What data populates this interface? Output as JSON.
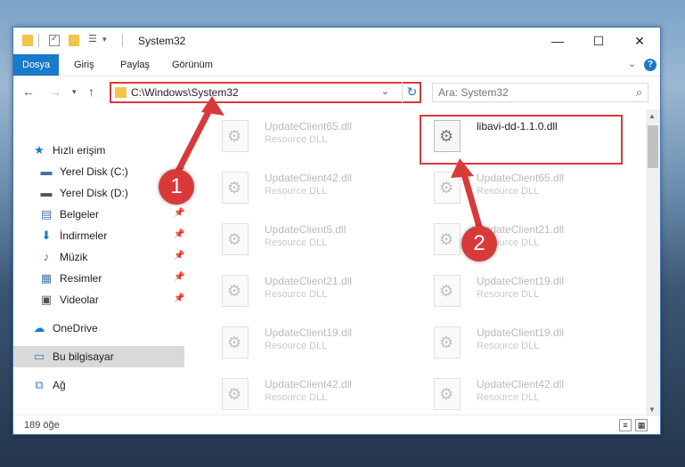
{
  "window": {
    "title": "System32",
    "controls": {
      "minimize": "—",
      "maximize": "☐",
      "close": "✕"
    }
  },
  "ribbon": {
    "tabs": [
      "Dosya",
      "Giriş",
      "Paylaş",
      "Görünüm"
    ],
    "active_tab": "Dosya",
    "help": "?"
  },
  "address_bar": {
    "path": "C:\\Windows\\System32",
    "dropdown": "⌄",
    "refresh": "↻"
  },
  "search": {
    "placeholder": "Ara: System32"
  },
  "sidebar": {
    "items": [
      {
        "label": "Hızlı erişim",
        "icon": "star-icon",
        "glyph": "★",
        "color": "#1979ca",
        "pinned": false
      },
      {
        "label": "Yerel Disk (C:)",
        "icon": "drive-c-icon",
        "glyph": "▬",
        "color": "#4a6fa5",
        "pinned": true
      },
      {
        "label": "Yerel Disk (D:)",
        "icon": "drive-d-icon",
        "glyph": "▬",
        "color": "#555",
        "pinned": false
      },
      {
        "label": "Belgeler",
        "icon": "documents-icon",
        "glyph": "▤",
        "color": "#4a78b5",
        "pinned": true
      },
      {
        "label": "İndirmeler",
        "icon": "downloads-icon",
        "glyph": "⬇",
        "color": "#1979ca",
        "pinned": true
      },
      {
        "label": "Müzik",
        "icon": "music-icon",
        "glyph": "♪",
        "color": "#1979ca",
        "pinned": true
      },
      {
        "label": "Resimler",
        "icon": "pictures-icon",
        "glyph": "▦",
        "color": "#4a78b5",
        "pinned": true
      },
      {
        "label": "Videolar",
        "icon": "videos-icon",
        "glyph": "▣",
        "color": "#555",
        "pinned": true
      },
      {
        "label": "OneDrive",
        "icon": "onedrive-icon",
        "glyph": "☁",
        "color": "#1979ca",
        "pinned": false
      },
      {
        "label": "Bu bilgisayar",
        "icon": "computer-icon",
        "glyph": "▭",
        "color": "#3a7bd5",
        "pinned": false
      },
      {
        "label": "Ağ",
        "icon": "network-icon",
        "glyph": "⧉",
        "color": "#3a7bd5",
        "pinned": false
      }
    ],
    "pin_glyph": "📌"
  },
  "files": {
    "left_column": [
      {
        "name": "UpdateClient65.dll",
        "type": "Resource DLL"
      },
      {
        "name": "UpdateClient42.dll",
        "type": "Resource DLL"
      },
      {
        "name": "UpdateClient5.dll",
        "type": "Resource DLL"
      },
      {
        "name": "UpdateClient21.dll",
        "type": "Resource DLL"
      },
      {
        "name": "UpdateClient19.dll",
        "type": "Resource DLL"
      },
      {
        "name": "UpdateClient42.dll",
        "type": "Resource DLL"
      }
    ],
    "right_column": [
      {
        "name": "libavi-dd-1.1.0.dll",
        "type": ""
      },
      {
        "name": "UpdateClient65.dll",
        "type": "Resource DLL"
      },
      {
        "name": "UpdateClient21.dll",
        "type": "Resource DLL"
      },
      {
        "name": "UpdateClient19.dll",
        "type": "Resource DLL"
      },
      {
        "name": "UpdateClient19.dll",
        "type": "Resource DLL"
      },
      {
        "name": "UpdateClient42.dll",
        "type": "Resource DLL"
      }
    ]
  },
  "status": {
    "count": "189 öğe"
  },
  "annotations": {
    "badge1": "1",
    "badge2": "2",
    "color": "#d83a3a"
  }
}
